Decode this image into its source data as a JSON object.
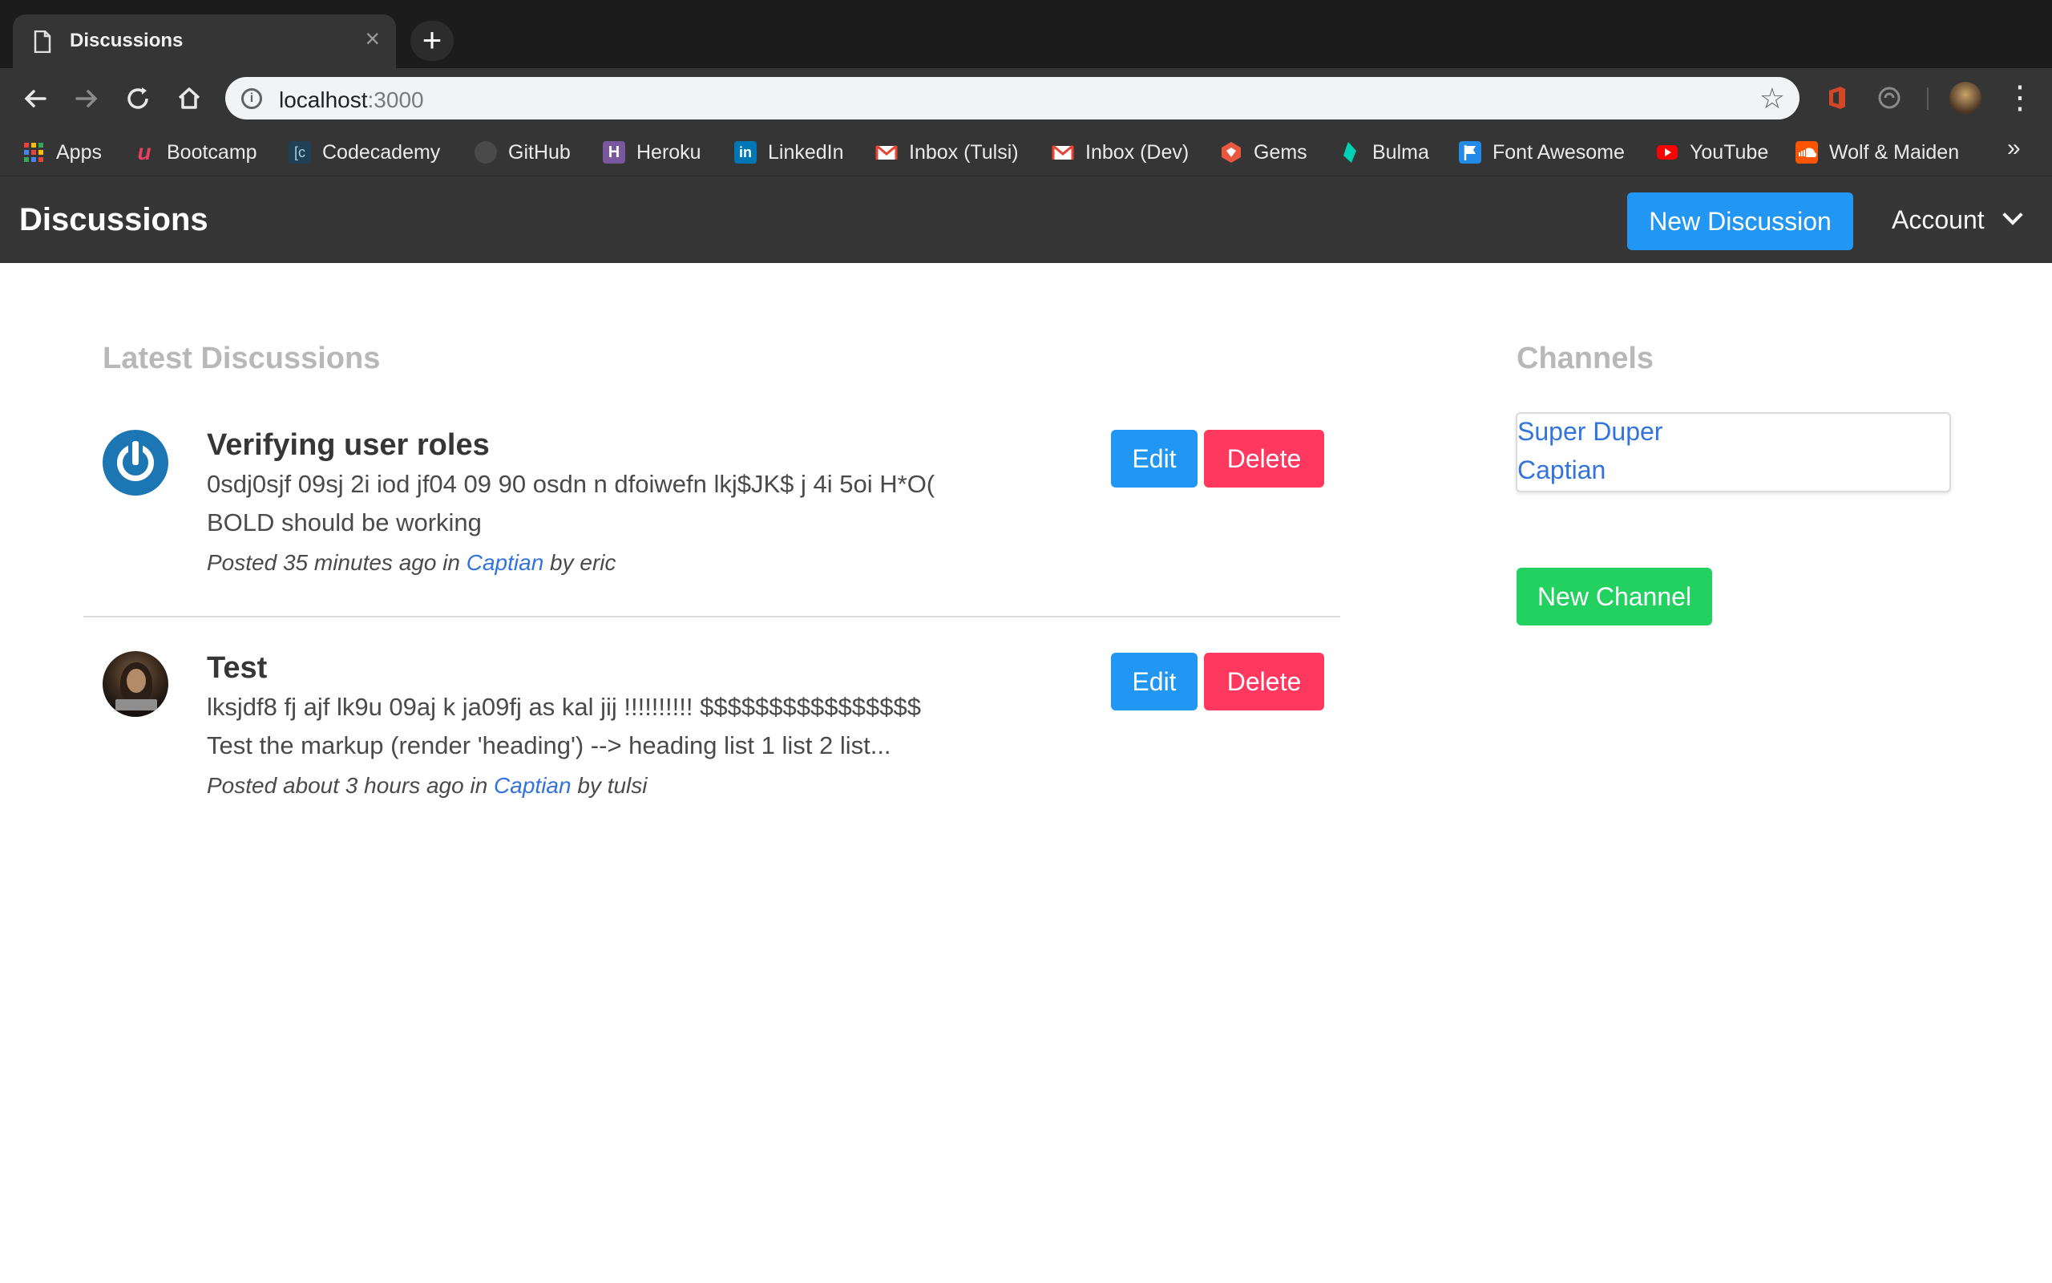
{
  "browser": {
    "tab_title": "Discussions",
    "url_host": "localhost",
    "url_port": ":3000",
    "bookmarks": [
      {
        "label": "Apps",
        "icon": "apps-grid-icon",
        "color": "#e94235"
      },
      {
        "label": "Bootcamp",
        "icon": "bootcamp-icon",
        "color": "#e4405f"
      },
      {
        "label": "Codecademy",
        "icon": "codecademy-icon",
        "color": "#204056"
      },
      {
        "label": "GitHub",
        "icon": "github-icon",
        "color": "#6e6e6e"
      },
      {
        "label": "Heroku",
        "icon": "heroku-icon",
        "color": "#79589f"
      },
      {
        "label": "LinkedIn",
        "icon": "linkedin-icon",
        "color": "#0077b5"
      },
      {
        "label": "Inbox (Tulsi)",
        "icon": "gmail-icon",
        "color": "#ea4335"
      },
      {
        "label": "Inbox (Dev)",
        "icon": "gmail-icon",
        "color": "#ea4335"
      },
      {
        "label": "Gems",
        "icon": "rubygems-icon",
        "color": "#e9573f"
      },
      {
        "label": "Bulma",
        "icon": "bulma-icon",
        "color": "#00d1b2"
      },
      {
        "label": "Font Awesome",
        "icon": "font-awesome-flag-icon",
        "color": "#228ae6"
      },
      {
        "label": "YouTube",
        "icon": "youtube-icon",
        "color": "#ff0000"
      },
      {
        "label": "Wolf & Maiden",
        "icon": "soundcloud-icon",
        "color": "#ff5500"
      }
    ],
    "more_bookmarks": "»"
  },
  "navbar": {
    "brand": "Discussions",
    "new_discussion_label": "New Discussion",
    "account_label": "Account"
  },
  "main": {
    "latest_title": "Latest Discussions",
    "discussions": [
      {
        "title": "Verifying user roles",
        "body_line1": "0sdj0sjf 09sj 2i iod jf04 09 90 osdn n dfoiwefn lkj$JK$ j 4i 5oi H*O(",
        "body_line2": "BOLD should be working",
        "meta_prefix": "Posted 35 minutes ago in ",
        "channel": "Captian",
        "meta_suffix": " by eric",
        "edit_label": "Edit",
        "delete_label": "Delete",
        "avatar": "power-icon"
      },
      {
        "title": "Test",
        "body_line1": "lksjdf8 fj ajf lk9u 09aj k ja09fj as kal jij !!!!!!!!!! $$$$$$$$$$$$$$$$",
        "body_line2": "Test the markup (render 'heading') --> heading list 1 list 2 list...",
        "meta_prefix": "Posted about 3 hours ago in ",
        "channel": "Captian",
        "meta_suffix": " by tulsi",
        "edit_label": "Edit",
        "delete_label": "Delete",
        "avatar": "user-photo"
      }
    ]
  },
  "sidebar": {
    "channels_title": "Channels",
    "channels": [
      "Super Duper",
      "Captian"
    ],
    "new_channel_label": "New Channel"
  },
  "colors": {
    "primary": "#2196f3",
    "danger": "#ff3860",
    "success": "#23d160",
    "link": "#3273dc",
    "navbar": "#363636"
  }
}
